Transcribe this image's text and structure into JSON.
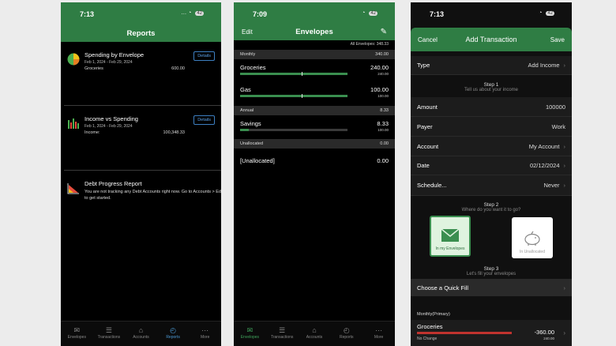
{
  "phone1": {
    "status_time": "7:13",
    "battery": "42",
    "title": "Reports",
    "reports": [
      {
        "title": "Spending by Envelope",
        "date": "Feb 1, 2024 - Feb 29, 2024",
        "row_label": "Groceries",
        "row_value": "600.00",
        "button": "Details"
      },
      {
        "title": "Income vs Spending",
        "date": "Feb 1, 2024 - Feb 29, 2024",
        "row_label": "Income:",
        "row_value": "100,348.33",
        "button": "Details"
      },
      {
        "title": "Debt Progress Report",
        "desc": "You are not tracking any Debt Accounts right now. Go to Accounts > Edit to get started."
      }
    ],
    "tabs": [
      "Envelopes",
      "Transactions",
      "Accounts",
      "Reports",
      "More"
    ]
  },
  "phone2": {
    "status_time": "7:09",
    "battery": "42",
    "title": "Envelopes",
    "edit": "Edit",
    "all_envelopes": "All Envelopes: 348.33",
    "monthly": {
      "label": "Monthly",
      "total": "340.00"
    },
    "groceries": {
      "name": "Groceries",
      "amount": "240.00",
      "sub": "240.00",
      "fill": 1.0
    },
    "gas": {
      "name": "Gas",
      "amount": "100.00",
      "sub": "100.00",
      "fill": 1.0
    },
    "annual": {
      "label": "Annual",
      "total": "8.33"
    },
    "savings": {
      "name": "Savings",
      "amount": "8.33",
      "sub": "100.00",
      "fill": 0.083
    },
    "unallocated_head": {
      "label": "Unallocated",
      "total": "0.00"
    },
    "unallocated_row": {
      "name": "[Unallocated]",
      "amount": "0.00"
    },
    "tabs": [
      "Envelopes",
      "Transactions",
      "Accounts",
      "Reports",
      "More"
    ]
  },
  "phone3": {
    "status_time": "7:13",
    "battery": "42",
    "cancel": "Cancel",
    "title": "Add Transaction",
    "save": "Save",
    "type_label": "Type",
    "type_value": "Add Income",
    "step1": "Step 1",
    "step1_sub": "Tell us about your income",
    "amount_label": "Amount",
    "amount_value": "100000",
    "payer_label": "Payer",
    "payer_value": "Work",
    "account_label": "Account",
    "account_value": "My Account",
    "date_label": "Date",
    "date_value": "02/12/2024",
    "schedule_label": "Schedule...",
    "schedule_value": "Never",
    "step2": "Step 2",
    "step2_sub": "Where do you want it to go?",
    "dest_envelopes": "In my Envelopes",
    "dest_unallocated": "In Unallocated",
    "step3": "Step 3",
    "step3_sub": "Let's fill your envelopes",
    "quick_fill": "Choose a Quick Fill",
    "monthly_primary": "Monthly(Primary)",
    "groceries_name": "Groceries",
    "groceries_amt": "-360.00",
    "groceries_sub": "240.00",
    "groceries_change": "No Change"
  },
  "colors": {
    "nav_green": "#2f7d44",
    "accent_blue": "#4c9bd6",
    "bar_green": "#3a8e4f",
    "bar_red": "#c0332e"
  }
}
